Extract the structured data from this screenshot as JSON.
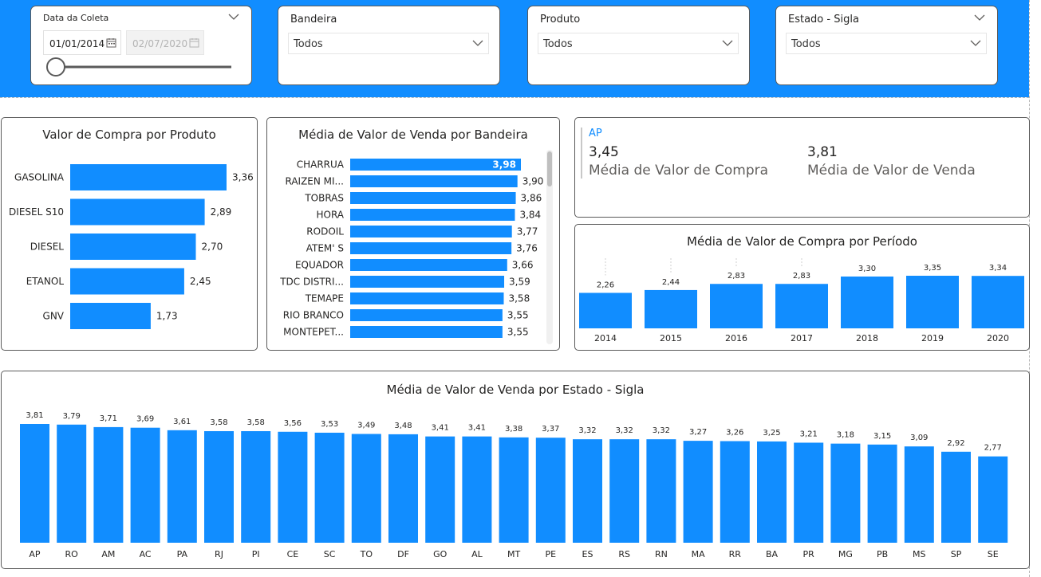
{
  "filters": {
    "date": {
      "title": "Data da Coleta",
      "start": "01/01/2014",
      "end": "02/07/2020",
      "slider_position": 0
    },
    "bandeira": {
      "title": "Bandeira",
      "value": "Todos"
    },
    "produto": {
      "title": "Produto",
      "value": "Todos"
    },
    "estado": {
      "title": "Estado - Sigla",
      "value": "Todos"
    }
  },
  "kpi": {
    "label": "AP",
    "compra_value": "3,45",
    "compra_label": "Média de Valor de Compra",
    "venda_value": "3,81",
    "venda_label": "Média de Valor de Venda"
  },
  "colors": {
    "accent": "#118DFF",
    "border": "#5a5a5a"
  },
  "chart_data": [
    {
      "id": "compra-produto",
      "type": "bar",
      "orientation": "horizontal",
      "title": "Valor de Compra por Produto",
      "categories": [
        "GASOLINA",
        "DIESEL S10",
        "DIESEL",
        "ETANOL",
        "GNV"
      ],
      "labels": [
        "3,36",
        "2,89",
        "2,70",
        "2,45",
        "1,73"
      ],
      "values": [
        3.36,
        2.89,
        2.7,
        2.45,
        1.73
      ]
    },
    {
      "id": "venda-bandeira",
      "type": "bar",
      "orientation": "horizontal",
      "title": "Média de Valor de Venda por Bandeira",
      "categories": [
        "CHARRUA",
        "RAIZEN MI...",
        "TOBRAS",
        "HORA",
        "RODOIL",
        "ATEM' S",
        "EQUADOR",
        "TDC DISTRI...",
        "TEMAPE",
        "RIO BRANCO",
        "MONTEPET..."
      ],
      "labels": [
        "3,98",
        "3,90",
        "3,86",
        "3,84",
        "3,77",
        "3,76",
        "3,66",
        "3,59",
        "3,58",
        "3,55",
        "3,55"
      ],
      "values": [
        3.98,
        3.9,
        3.86,
        3.84,
        3.77,
        3.76,
        3.66,
        3.59,
        3.58,
        3.55,
        3.55
      ]
    },
    {
      "id": "compra-periodo",
      "type": "bar",
      "title": "Média de Valor de Compra por Período",
      "categories": [
        "2014",
        "2015",
        "2016",
        "2017",
        "2018",
        "2019",
        "2020"
      ],
      "labels": [
        "2,26",
        "2,44",
        "2,83",
        "2,83",
        "3,30",
        "3,35",
        "3,34"
      ],
      "values": [
        2.26,
        2.44,
        2.83,
        2.83,
        3.3,
        3.35,
        3.34
      ]
    },
    {
      "id": "venda-estado",
      "type": "bar",
      "title": "Média de Valor de Venda por Estado - Sigla",
      "categories": [
        "AP",
        "RO",
        "AM",
        "AC",
        "PA",
        "RJ",
        "PI",
        "CE",
        "SC",
        "TO",
        "DF",
        "GO",
        "AL",
        "MT",
        "PE",
        "ES",
        "RS",
        "RN",
        "MA",
        "RR",
        "BA",
        "PR",
        "MG",
        "PB",
        "MS",
        "SP",
        "SE"
      ],
      "labels": [
        "3,81",
        "3,79",
        "3,71",
        "3,69",
        "3,61",
        "3,58",
        "3,58",
        "3,56",
        "3,53",
        "3,49",
        "3,48",
        "3,41",
        "3,41",
        "3,38",
        "3,37",
        "3,32",
        "3,32",
        "3,32",
        "3,27",
        "3,26",
        "3,25",
        "3,21",
        "3,18",
        "3,15",
        "3,09",
        "2,92",
        "2,77"
      ],
      "values": [
        3.81,
        3.79,
        3.71,
        3.69,
        3.61,
        3.58,
        3.58,
        3.56,
        3.53,
        3.49,
        3.48,
        3.41,
        3.41,
        3.38,
        3.37,
        3.32,
        3.32,
        3.32,
        3.27,
        3.26,
        3.25,
        3.21,
        3.18,
        3.15,
        3.09,
        2.92,
        2.77
      ]
    }
  ]
}
